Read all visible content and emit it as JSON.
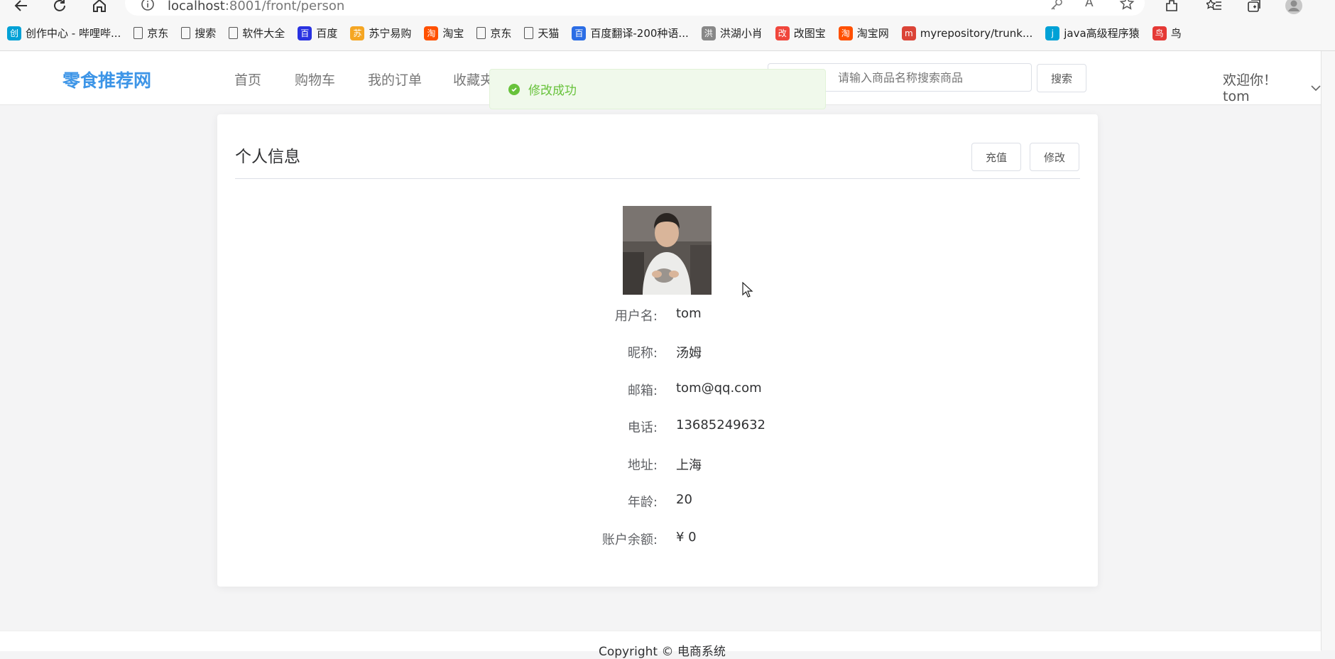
{
  "browser": {
    "url_host": "localhost",
    "url_rest": ":8001/front/person",
    "bookmarks": [
      {
        "label": "创作中心 - 哔哩哔...",
        "icon": "bilibili-icon",
        "color": "#00a1d6"
      },
      {
        "label": "京东",
        "icon": "page-icon",
        "color": ""
      },
      {
        "label": "搜索",
        "icon": "page-icon",
        "color": ""
      },
      {
        "label": "软件大全",
        "icon": "page-icon",
        "color": ""
      },
      {
        "label": "百度",
        "icon": "baidu-icon",
        "color": "#2932e1"
      },
      {
        "label": "苏宁易购",
        "icon": "suning-icon",
        "color": "#f5a623"
      },
      {
        "label": "淘宝",
        "icon": "taobao-icon",
        "color": "#ff5000"
      },
      {
        "label": "京东",
        "icon": "page-icon",
        "color": ""
      },
      {
        "label": "天猫",
        "icon": "page-icon",
        "color": ""
      },
      {
        "label": "百度翻译-200种语...",
        "icon": "translate-icon",
        "color": "#2b6de5"
      },
      {
        "label": "洪湖小肖",
        "icon": "bird-icon",
        "color": "#888888"
      },
      {
        "label": "改图宝",
        "icon": "gaitubao-icon",
        "color": "#f0463c"
      },
      {
        "label": "淘宝网",
        "icon": "taobao-icon",
        "color": "#ff5000"
      },
      {
        "label": "myrepository/trunk...",
        "icon": "chrome-icon",
        "color": "#db4437"
      },
      {
        "label": "java高级程序猿",
        "icon": "bilibili-icon",
        "color": "#00a1d6"
      },
      {
        "label": "鸟",
        "icon": "bird-icon",
        "color": "#e53935"
      }
    ]
  },
  "header": {
    "logo": "零食推荐网",
    "nav": [
      "首页",
      "购物车",
      "我的订单",
      "收藏夹"
    ],
    "search_placeholder": "请输入商品名称搜索商品",
    "search_button": "搜索",
    "welcome": "欢迎你！ tom"
  },
  "toast": {
    "message": "修改成功",
    "color": "#67c23a"
  },
  "profile": {
    "title": "个人信息",
    "recharge_button": "充值",
    "edit_button": "修改",
    "fields": [
      {
        "label": "用户名:",
        "value": "tom"
      },
      {
        "label": "昵称:",
        "value": "汤姆"
      },
      {
        "label": "邮箱:",
        "value": "tom@qq.com"
      },
      {
        "label": "电话:",
        "value": "13685249632"
      },
      {
        "label": "地址:",
        "value": "上海"
      },
      {
        "label": "年龄:",
        "value": "20"
      },
      {
        "label": "账户余额:",
        "value": "¥ 0"
      }
    ]
  },
  "footer": {
    "text": "Copyright © 电商系统"
  },
  "colors": {
    "brand": "#3d95e7",
    "success": "#67c23a"
  }
}
